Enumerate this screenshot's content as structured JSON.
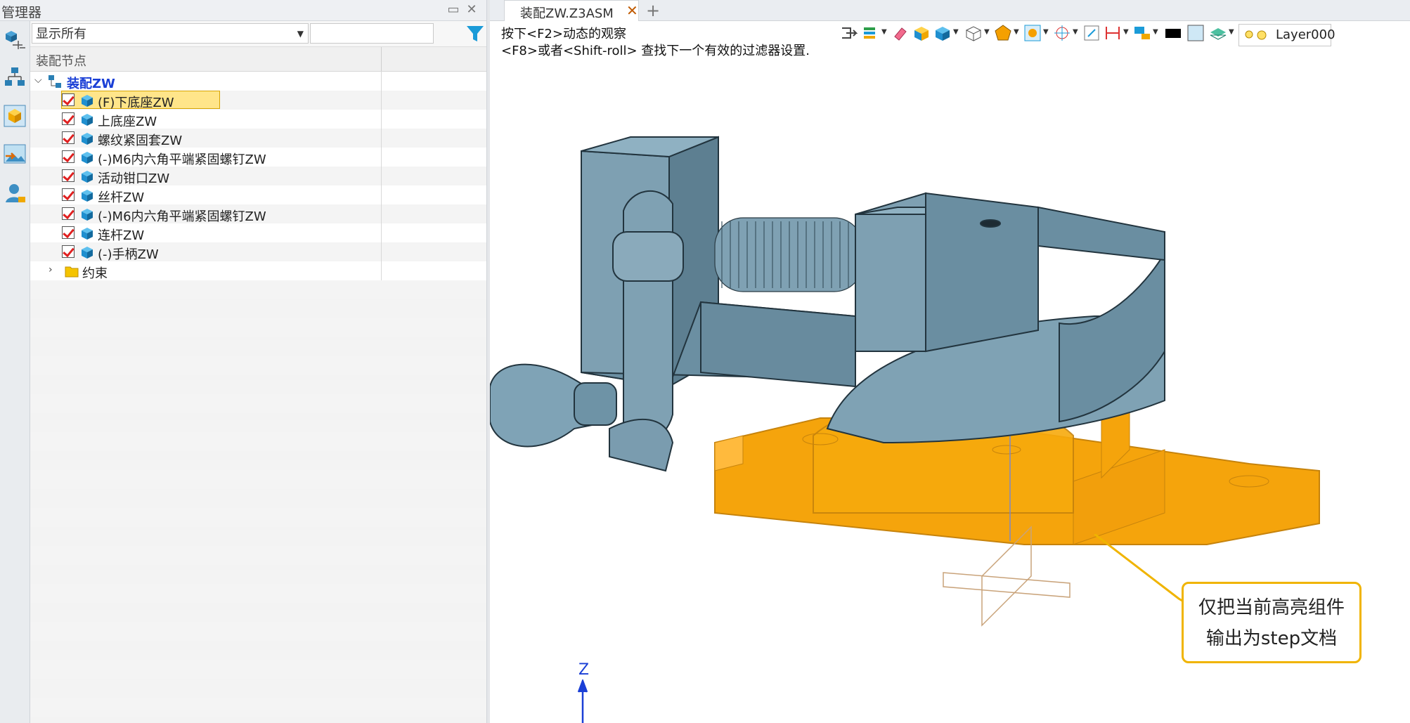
{
  "manager": {
    "title": "管理器",
    "filter_value": "显示所有",
    "filter_input_value": "",
    "tree_header": "装配节点",
    "root_label": "装配ZW",
    "items": [
      {
        "label": "(F)下底座ZW",
        "highlighted": true
      },
      {
        "label": "上底座ZW"
      },
      {
        "label": "螺纹紧固套ZW"
      },
      {
        "label": "(-)M6内六角平端紧固螺钉ZW"
      },
      {
        "label": "活动钳口ZW"
      },
      {
        "label": "丝杆ZW"
      },
      {
        "label": "(-)M6内六角平端紧固螺钉ZW"
      },
      {
        "label": "连杆ZW"
      },
      {
        "label": "(-)手柄ZW"
      }
    ],
    "constraints_label": "约束"
  },
  "tab": {
    "title": "装配ZW.Z3ASM",
    "close_glyph": "✕",
    "add_glyph": "+"
  },
  "viewport": {
    "hint_line1": "按下<F2>动态的观察",
    "hint_line2": "<F8>或者<Shift-roll> 查找下一个有效的过滤器设置.",
    "layer_name": "Layer000",
    "callout_line1": "仅把当前高亮组件",
    "callout_line2": "输出为step文档",
    "axis_label": "Z"
  },
  "colors": {
    "part_blue": "#6e93a6",
    "highlight_orange": "#f5a000",
    "accent_blue": "#1a3fd6",
    "check_red": "#e02020"
  },
  "icons": [
    "assembly-icon",
    "tree-icon",
    "part-box-icon",
    "image-import-icon",
    "user-icon",
    "filter-icon",
    "list-settings-icon",
    "part-icon",
    "folder-icon"
  ]
}
